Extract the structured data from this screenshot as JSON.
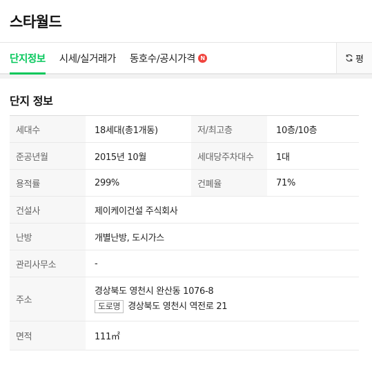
{
  "header": {
    "title": "스타월드"
  },
  "tabs": [
    {
      "label": "단지정보",
      "active": true
    },
    {
      "label": "시세/실거래가",
      "active": false
    },
    {
      "label": "동호수/공시가격",
      "active": false,
      "badge": "N"
    }
  ],
  "pyeong_button": {
    "label": "평",
    "icon": "refresh-icon"
  },
  "section": {
    "title": "단지 정보"
  },
  "info": {
    "households_label": "세대수",
    "households_value": "18세대(총1개동)",
    "floors_label": "저/최고층",
    "floors_value": "10층/10층",
    "completion_label": "준공년월",
    "completion_value": "2015년 10월",
    "parking_label": "세대당주차대수",
    "parking_value": "1대",
    "far_label": "용적률",
    "far_value": "299%",
    "bcr_label": "건폐율",
    "bcr_value": "71%",
    "builder_label": "건설사",
    "builder_value": "제이케이건설 주식회사",
    "heating_label": "난방",
    "heating_value": "개별난방, 도시가스",
    "office_label": "관리사무소",
    "office_value": "-",
    "address_label": "주소",
    "address_lot": "경상북도 영천시 완산동 1076-8",
    "address_road_tag": "도로명",
    "address_road": "경상북도 영천시 역전로 21",
    "area_label": "면적",
    "area_value": "111㎡"
  },
  "colors": {
    "accent": "#03c75a",
    "badge": "#f0443e"
  }
}
